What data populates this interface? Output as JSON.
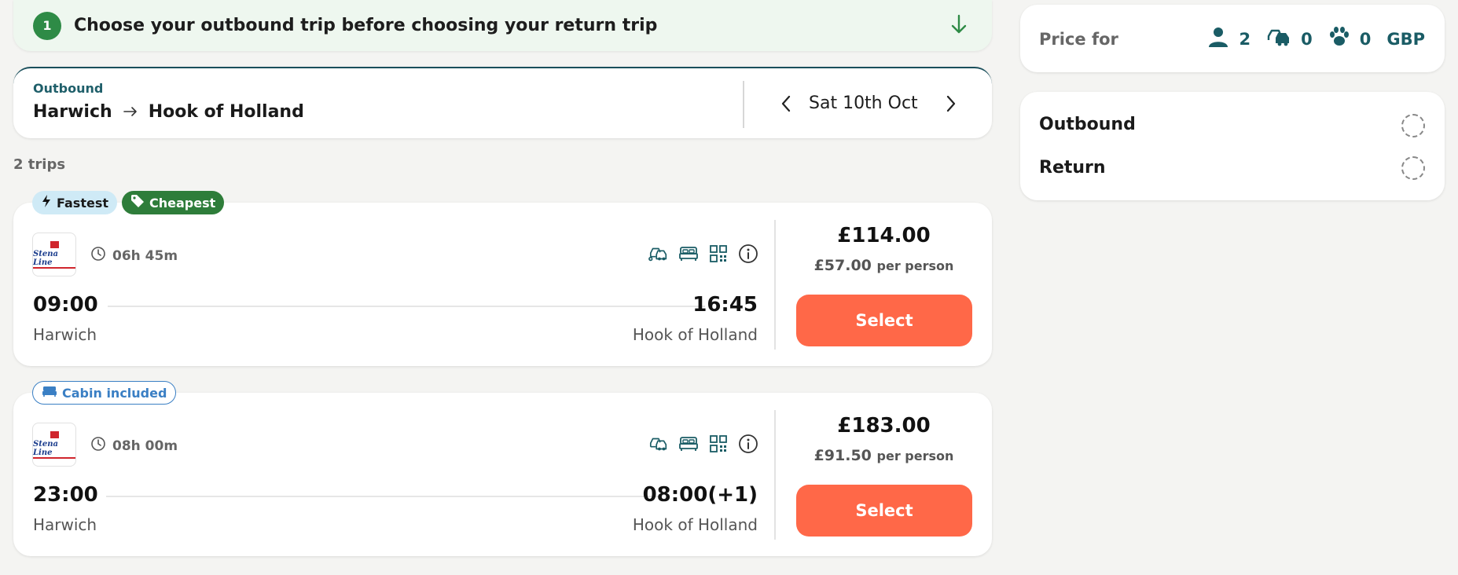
{
  "banner": {
    "step_number": "1",
    "text": "Choose your outbound trip before choosing your return trip"
  },
  "route": {
    "label": "Outbound",
    "from": "Harwich",
    "to": "Hook of Holland",
    "date": "Sat 10th Oct"
  },
  "trips_count": "2 trips",
  "tags": {
    "fastest": "Fastest",
    "cheapest": "Cheapest",
    "cabin": "Cabin included"
  },
  "trips": [
    {
      "operator": "Stena Line",
      "duration": "06h 45m",
      "depart_time": "09:00",
      "arrive_time": "16:45",
      "depart_place": "Harwich",
      "arrive_place": "Hook of Holland",
      "price": "£114.00",
      "per_person_price": "£57.00",
      "per_person_label": "per person",
      "select_label": "Select",
      "amenities": [
        "vehicle-icon",
        "bed-icon",
        "qr-code-icon",
        "info-icon"
      ]
    },
    {
      "operator": "Stena Line",
      "duration": "08h 00m",
      "depart_time": "23:00",
      "arrive_time": "08:00(+1)",
      "depart_place": "Harwich",
      "arrive_place": "Hook of Holland",
      "price": "£183.00",
      "per_person_price": "£91.50",
      "per_person_label": "per person",
      "select_label": "Select",
      "amenities": [
        "vehicle-icon",
        "bed-icon",
        "qr-code-icon",
        "info-icon"
      ]
    }
  ],
  "price_for": {
    "label": "Price for",
    "passengers": "2",
    "vehicles": "0",
    "pets": "0",
    "currency": "GBP"
  },
  "summary": {
    "outbound": "Outbound",
    "return": "Return"
  },
  "colors": {
    "accent": "#ff6848",
    "brand_teal": "#1a5c65",
    "step_green": "#2e8b46",
    "cheapest_green": "#2e7d3a",
    "fastest_blue": "#cfeaf6",
    "cabin_blue": "#3a7fc4"
  }
}
